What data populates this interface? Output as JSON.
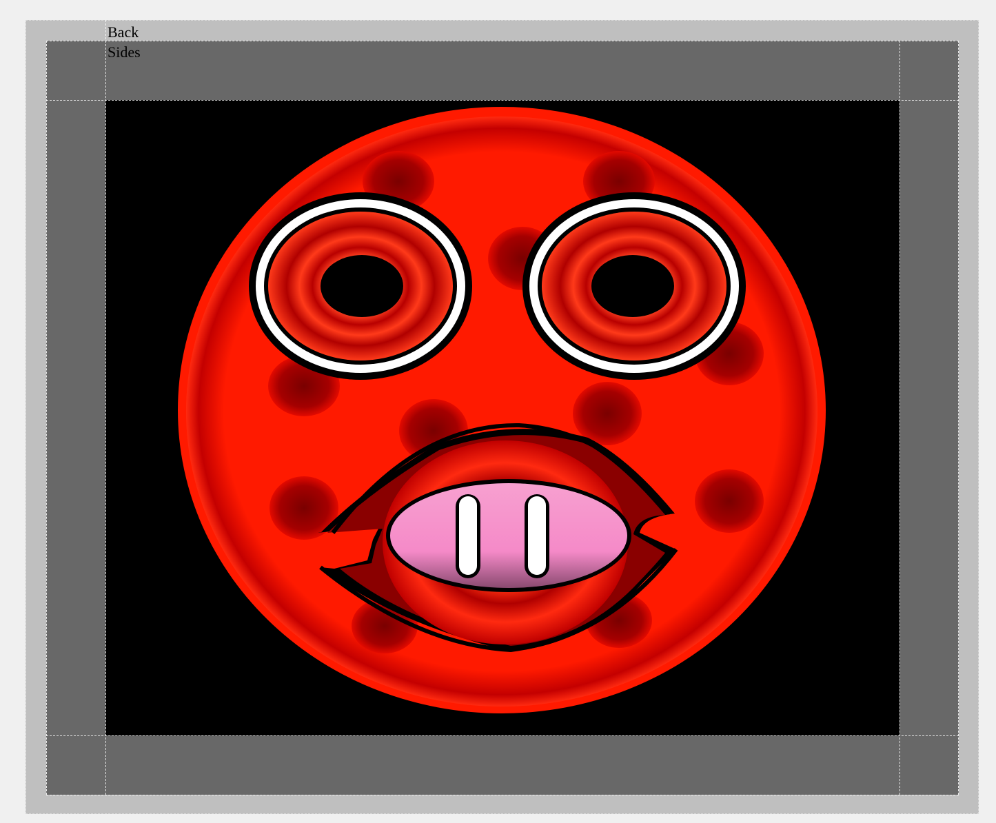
{
  "labels": {
    "back": "Back",
    "sides": "Sides"
  },
  "colors": {
    "page_background": "#f0f0f0",
    "outer_frame": "#bfbfbf",
    "inner_frame": "#686868",
    "canvas": "#000000",
    "face_red": "#ff1a00",
    "spot_dark_red": "#7a0000",
    "tongue_pink": "#f58ac8",
    "outline": "#000000",
    "ring_white": "#ffffff"
  },
  "artwork": {
    "subject": "red-spotted-face",
    "features": [
      "face-disc-icon",
      "left-eye-icon",
      "right-eye-icon",
      "mouth-icon",
      "spot-icon"
    ]
  }
}
